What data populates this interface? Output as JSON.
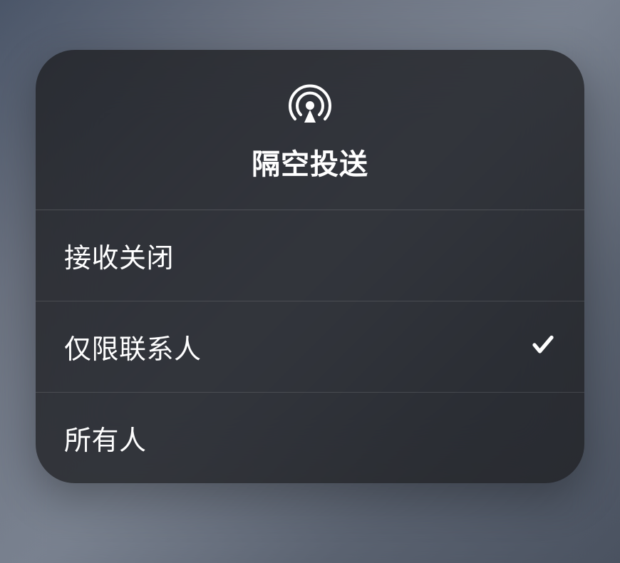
{
  "panel": {
    "title": "隔空投送",
    "icon": "airdrop-icon",
    "options": [
      {
        "label": "接收关闭",
        "selected": false
      },
      {
        "label": "仅限联系人",
        "selected": true
      },
      {
        "label": "所有人",
        "selected": false
      }
    ]
  }
}
